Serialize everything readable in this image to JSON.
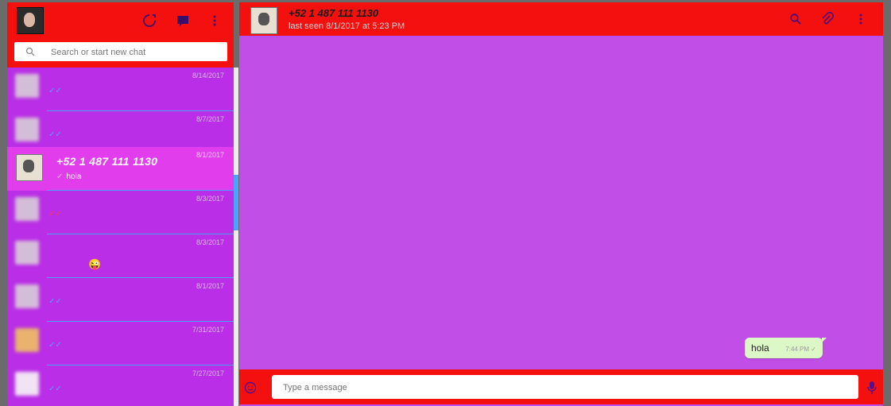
{
  "colors": {
    "header_red": "#f51010",
    "chat_purple": "#b92ee6",
    "active_pink": "#e23ded",
    "message_bg": "#c24ee8",
    "divider_blue": "#4aa3ff",
    "outgoing_bubble": "#dcf8c6"
  },
  "left_header": {
    "icons": [
      "status-icon",
      "new-chat-icon",
      "menu-icon"
    ]
  },
  "search": {
    "placeholder": "Search or start new chat"
  },
  "chats": [
    {
      "date": "8/14/2017",
      "ticks": "✓✓"
    },
    {
      "date": "8/7/2017",
      "ticks": "✓✓"
    },
    {
      "date": "8/1/2017",
      "name": "+52 1 487 111 1130",
      "preview": "hola",
      "tick": "✓",
      "active": true
    },
    {
      "date": "8/3/2017",
      "ticks": "✓✓"
    },
    {
      "date": "8/3/2017",
      "emoji": "😜"
    },
    {
      "date": "8/1/2017",
      "ticks": "✓✓"
    },
    {
      "date": "7/31/2017",
      "ticks": "✓✓"
    },
    {
      "date": "7/27/2017",
      "ticks": "✓✓"
    }
  ],
  "conversation": {
    "contact_name": "+52 1 487 111 1130",
    "last_seen": "last seen 8/1/2017 at 5:23 PM",
    "header_icons": [
      "search-icon",
      "attach-icon",
      "menu-icon"
    ]
  },
  "messages": [
    {
      "text": "hola",
      "time": "7:44 PM",
      "tick": "✓"
    }
  ],
  "composer": {
    "placeholder": "Type a message"
  }
}
